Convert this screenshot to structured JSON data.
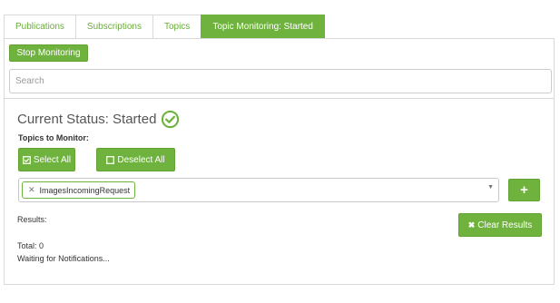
{
  "tabs": [
    {
      "label": "Publications",
      "active": false
    },
    {
      "label": "Subscriptions",
      "active": false
    },
    {
      "label": "Topics",
      "active": false
    },
    {
      "label": "Topic Monitoring: Started",
      "active": true
    }
  ],
  "toolbar": {
    "stop_label": "Stop Monitoring"
  },
  "search": {
    "placeholder": "Search"
  },
  "status": {
    "text": "Current Status: Started",
    "icon": "check-circle-icon"
  },
  "topics": {
    "label": "Topics to Monitor:",
    "select_all_label": "Select All",
    "deselect_all_label": "Deselect All",
    "selected": [
      "ImagesIncomingRequest"
    ],
    "add_label": "+"
  },
  "results": {
    "label": "Results:",
    "clear_label": "Clear Results",
    "total": "Total: 0",
    "message": "Waiting for Notifications..."
  },
  "colors": {
    "accent": "#6fb33e",
    "border": "#d9d9d9",
    "tab_text": "#6aac3a"
  }
}
